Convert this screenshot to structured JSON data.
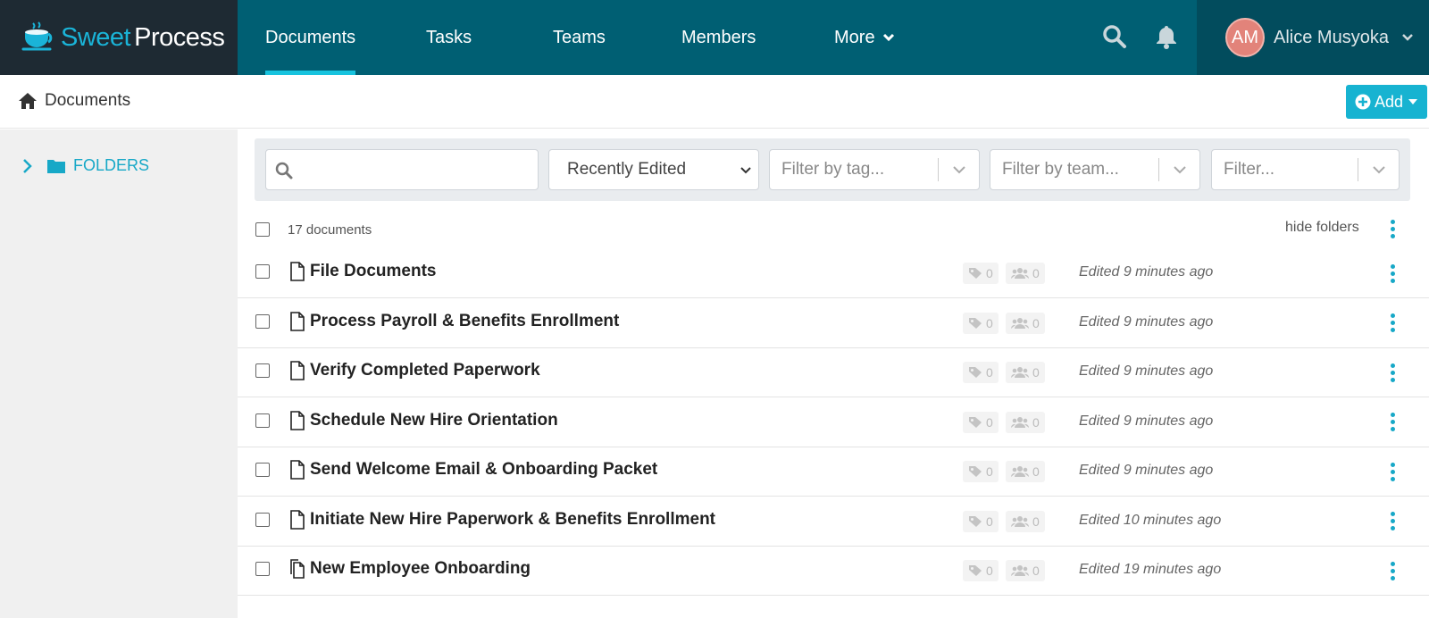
{
  "brand": {
    "name_part1": "Sweet",
    "name_part2": "Process"
  },
  "nav": {
    "items": [
      {
        "label": "Documents",
        "active": true
      },
      {
        "label": "Tasks"
      },
      {
        "label": "Teams"
      },
      {
        "label": "Members"
      },
      {
        "label": "More"
      }
    ],
    "icons": [
      "search-icon",
      "bell-icon"
    ]
  },
  "user": {
    "initials": "AM",
    "name": "Alice Musyoka"
  },
  "breadcrumb": {
    "label": "Documents"
  },
  "add_button": {
    "label": "Add"
  },
  "sidebar": {
    "folders_label": "FOLDERS"
  },
  "filters": {
    "search_placeholder": "",
    "sort_value": "Recently Edited",
    "tag_placeholder": "Filter by tag...",
    "team_placeholder": "Filter by team...",
    "other_placeholder": "Filter..."
  },
  "list": {
    "count_label": "17 documents",
    "hide_folders_label": "hide folders",
    "documents": [
      {
        "title": "File Documents",
        "tags": "0",
        "teams": "0",
        "edited": "Edited 9 minutes ago",
        "icon": "file-icon"
      },
      {
        "title": "Process Payroll & Benefits Enrollment",
        "tags": "0",
        "teams": "0",
        "edited": "Edited 9 minutes ago",
        "icon": "file-icon"
      },
      {
        "title": "Verify Completed Paperwork",
        "tags": "0",
        "teams": "0",
        "edited": "Edited 9 minutes ago",
        "icon": "file-icon"
      },
      {
        "title": "Schedule New Hire Orientation",
        "tags": "0",
        "teams": "0",
        "edited": "Edited 9 minutes ago",
        "icon": "file-icon"
      },
      {
        "title": "Send Welcome Email & Onboarding Packet",
        "tags": "0",
        "teams": "0",
        "edited": "Edited 9 minutes ago",
        "icon": "file-icon"
      },
      {
        "title": "Initiate New Hire Paperwork & Benefits Enrollment",
        "tags": "0",
        "teams": "0",
        "edited": "Edited 10 minutes ago",
        "icon": "file-icon"
      },
      {
        "title": "New Employee Onboarding",
        "tags": "0",
        "teams": "0",
        "edited": "Edited 19 minutes ago",
        "icon": "copy-icon"
      }
    ]
  },
  "colors": {
    "nav_bg": "#005f73",
    "brand_bg": "#1e2a33",
    "accent": "#17b3d1",
    "sidebar_bg": "#f0f0f0"
  }
}
